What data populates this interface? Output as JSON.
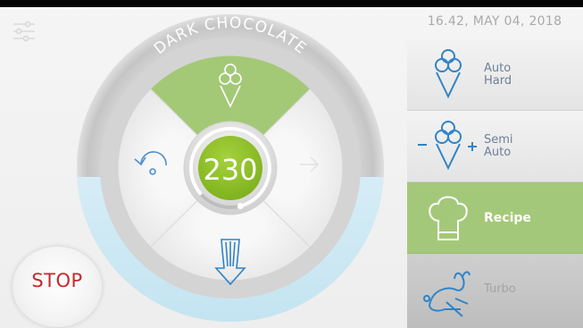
{
  "header": {
    "datetime": "16.42, MAY 04, 2018"
  },
  "product": {
    "name": "DARK CHOCOLATE"
  },
  "dial": {
    "value": "230",
    "progress": 0.82
  },
  "stop": {
    "label": "STOP"
  },
  "menu": {
    "items": [
      {
        "label": "Auto\nHard",
        "icon": "ice-cream-cone-icon"
      },
      {
        "label": "Semi\nAuto",
        "icon": "ice-cream-cone-plus-minus-icon"
      },
      {
        "label": "Recipe",
        "icon": "chef-hat-icon",
        "active": true
      },
      {
        "label": "Turbo",
        "icon": "rabbit-icon"
      }
    ]
  },
  "colors": {
    "accent_green": "#8fc12d",
    "selected_green": "#a4c879",
    "stop_red": "#c6282d",
    "icon_blue": "#2f84c9"
  }
}
